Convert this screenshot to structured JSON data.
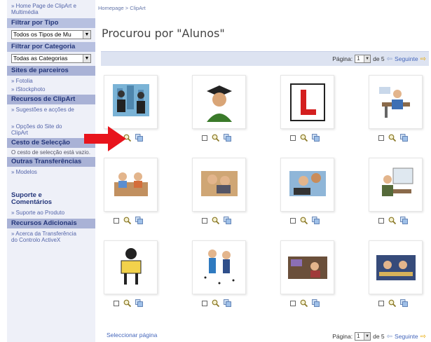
{
  "sidebar": {
    "home_link": "» Home Page de ClipArt e Multimédia",
    "filter_type_heading": "Filtrar por Tipo",
    "filter_type_value": "Todos os Tipos de Mu",
    "filter_category_heading": "Filtrar por Categoria",
    "filter_category_value": "Todas as Categorias",
    "partner_sites_heading": "Sites de parceiros",
    "partner_links": [
      "» Fotolia",
      "» iStockphoto"
    ],
    "clipart_resources_heading": "Recursos de ClipArt",
    "clipart_resources_links": [
      "» Sugestões e acções de",
      "» Opções do Site do ClipArt"
    ],
    "basket_heading": "Cesto de Selecção",
    "basket_text": "O cesto de selecção está vazio.",
    "other_downloads_heading": "Outras Transferências",
    "other_downloads_links": [
      "» Modelos"
    ],
    "support_heading": "Suporte e Comentários",
    "support_links": [
      "» Suporte ao Produto"
    ],
    "additional_resources_heading": "Recursos Adicionais",
    "additional_resources_links": [
      "» Acerca da Transferência do Controlo ActiveX"
    ]
  },
  "breadcrumb": "Homepage > ClipArt",
  "page_title": "Procurou por \"Alunos\"",
  "pager": {
    "page_label": "Página:",
    "current_page": "1",
    "of_total": "de 5",
    "next_label": "Seguinte"
  },
  "select_page_label": "Seleccionar página",
  "results": [
    {
      "icon": "students-city-clipart"
    },
    {
      "icon": "graduate-clipart"
    },
    {
      "icon": "learner-l-plate-clipart"
    },
    {
      "icon": "student-desk-clipart"
    },
    {
      "icon": "students-reading-clipart"
    },
    {
      "icon": "students-computer-clipart"
    },
    {
      "icon": "students-laptop-clipart"
    },
    {
      "icon": "teacher-board-clipart"
    },
    {
      "icon": "student-reading-book-clipart"
    },
    {
      "icon": "students-music-clipart"
    },
    {
      "icon": "classroom-photo-clipart"
    },
    {
      "icon": "school-bus-clipart"
    }
  ],
  "colors": {
    "sidebar_bg": "#eef0f8",
    "sidebar_heading_bg": "#b7c0e0",
    "pager_bar_bg": "#dde3f1",
    "arrow_red": "#e8141c"
  }
}
